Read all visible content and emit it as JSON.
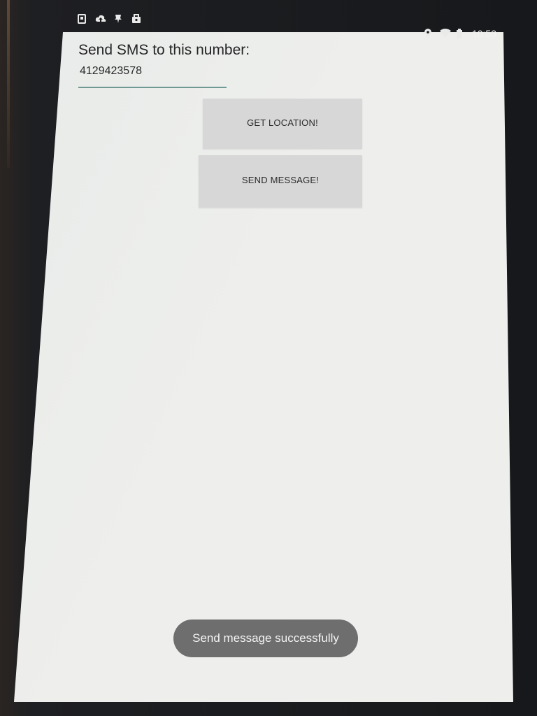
{
  "status_bar": {
    "left_icons": [
      "sim-card-icon",
      "cloud-upload-icon",
      "pin-icon",
      "briefcase-icon"
    ],
    "right_icons": [
      "location-icon",
      "wifi-icon",
      "battery-icon"
    ],
    "time": "10:53"
  },
  "form": {
    "label": "Send SMS to this number:",
    "phone_value": "4129423578",
    "underline_color": "#6f9a94"
  },
  "buttons": {
    "get_location": "GET LOCATION!",
    "send_message": "SEND MESSAGE!"
  },
  "toast": {
    "message": "Send message successfully"
  }
}
